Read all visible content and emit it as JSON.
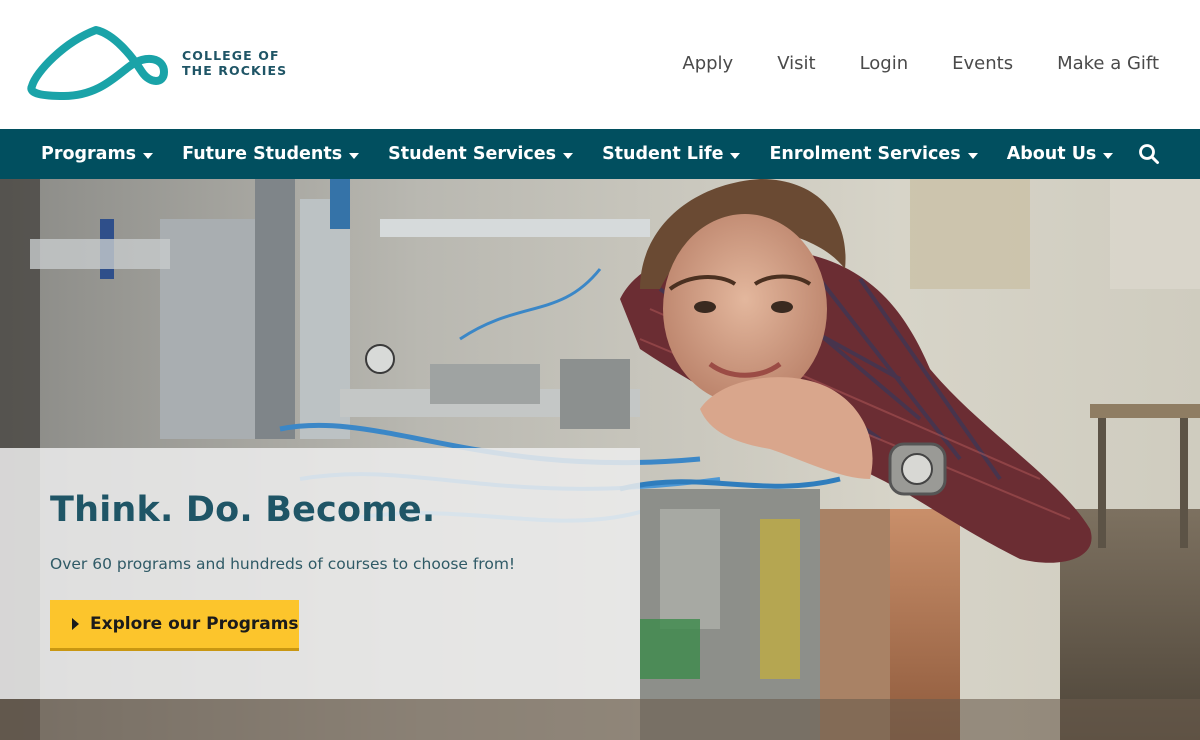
{
  "brand": {
    "name_line1": "COLLEGE OF",
    "name_line2": "THE ROCKIES",
    "logo_color": "#1aa3a8"
  },
  "utility_nav": {
    "items": [
      {
        "label": "Apply"
      },
      {
        "label": "Visit"
      },
      {
        "label": "Login"
      },
      {
        "label": "Events"
      },
      {
        "label": "Make a Gift"
      }
    ]
  },
  "main_nav": {
    "background": "#014f5f",
    "items": [
      {
        "label": "Programs",
        "icon": "caret-down-icon"
      },
      {
        "label": "Future Students",
        "icon": "caret-down-icon"
      },
      {
        "label": "Student Services",
        "icon": "caret-down-icon"
      },
      {
        "label": "Student Life",
        "icon": "caret-down-icon"
      },
      {
        "label": "Enrolment Services",
        "icon": "caret-down-icon"
      },
      {
        "label": "About Us",
        "icon": "caret-down-icon"
      }
    ],
    "search_icon": "search-icon"
  },
  "hero": {
    "title": "Think. Do. Become.",
    "subtitle": "Over 60 programs and hundreds of courses to choose from!",
    "cta_label": "Explore our Programs",
    "cta_icon": "caret-right-icon",
    "cta_color": "#fcc52c"
  }
}
